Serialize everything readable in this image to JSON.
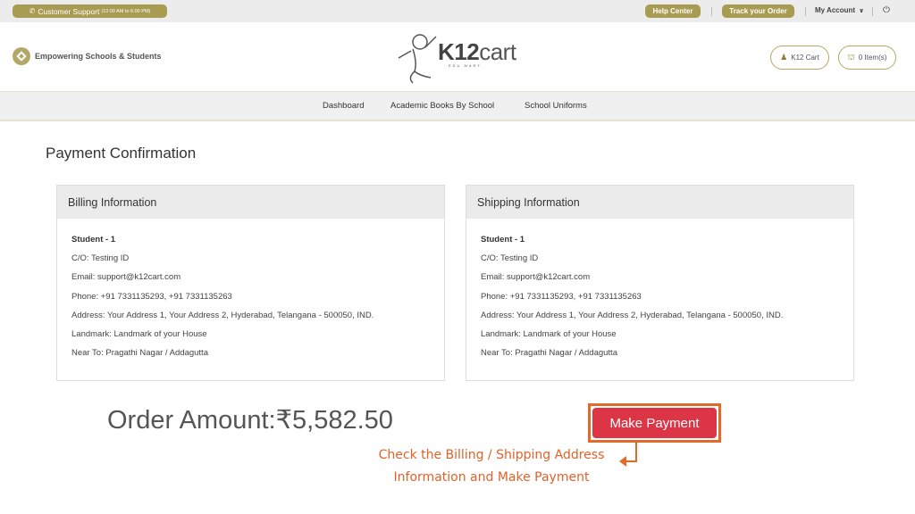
{
  "topbar": {
    "support_label": "Customer Support",
    "support_hours": "(10:00 AM to 6:00 PM)",
    "help_center": "Help Center",
    "track_order": "Track your Order",
    "my_account": "My Account",
    "chevron": "⌄",
    "power_icon": "⏻"
  },
  "header": {
    "tagline": "Empowering Schools & Students",
    "logo_main": "K12",
    "logo_cart": "cart",
    "logo_sub": "EDU MART",
    "k12cart_button": "K12 Cart",
    "items_button": "0 Item(s)"
  },
  "nav": {
    "items": [
      "Dashboard",
      "Academic Books By School",
      "School Uniforms"
    ]
  },
  "page": {
    "title": "Payment Confirmation"
  },
  "billing": {
    "heading": "Billing Information",
    "name": "Student - 1",
    "care_of": "C/O: Testing ID",
    "email": "Email: support@k12cart.com",
    "phone": "Phone: +91 7331135293, +91 7331135263",
    "address": "Address: Your Address 1, Your Address 2, Hyderabad, Telangana - 500050, IND.",
    "landmark": "Landmark: Landmark of your House",
    "near_to": "Near To: Pragathi Nagar / Addagutta"
  },
  "shipping": {
    "heading": "Shipping Information",
    "name": "Student - 1",
    "care_of": "C/O: Testing ID",
    "email": "Email: support@k12cart.com",
    "phone": "Phone: +91 7331135293, +91 7331135263",
    "address": "Address: Your Address 1, Your Address 2, Hyderabad, Telangana - 500050, IND.",
    "landmark": "Landmark: Landmark of your House",
    "near_to": "Near To: Pragathi Nagar / Addagutta"
  },
  "order": {
    "label": "Order Amount:",
    "amount": "₹5,582.50",
    "pay_button": "Make Payment"
  },
  "annotation": {
    "line1": "Check the Billing / Shipping Address",
    "line2": "Information and Make Payment"
  },
  "colors": {
    "gold": "#a89b52",
    "pay_button": "#dc3545",
    "annotation": "#e0622a"
  }
}
